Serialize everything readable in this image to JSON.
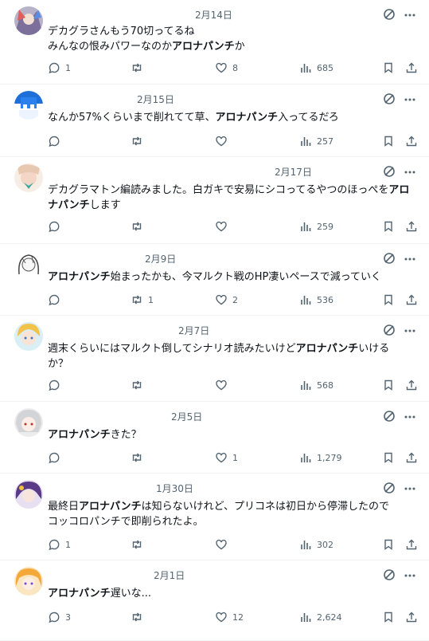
{
  "posts": [
    {
      "date": "2月14日",
      "segments": [
        {
          "t": "デカグラさんもう70切ってるね\nみんなの恨みパワーなのか"
        },
        {
          "t": "アロナパンチ",
          "b": true
        },
        {
          "t": "か"
        }
      ],
      "replies": "1",
      "retweets": "",
      "likes": "8",
      "views": "685"
    },
    {
      "date": "2月15日",
      "segments": [
        {
          "t": "なんか57%くらいまで削れてて草、"
        },
        {
          "t": "アロナパンチ",
          "b": true
        },
        {
          "t": "入ってるだろ"
        }
      ],
      "replies": "",
      "retweets": "",
      "likes": "",
      "views": "257"
    },
    {
      "date": "2月17日",
      "segments": [
        {
          "t": "デカグラマトン編読みました。白ガキで安易にシコってるやつのほっぺを"
        },
        {
          "t": "アロナパンチ",
          "b": true
        },
        {
          "t": "します"
        }
      ],
      "replies": "",
      "retweets": "",
      "likes": "",
      "views": "259"
    },
    {
      "date": "2月9日",
      "segments": [
        {
          "t": "アロナパンチ",
          "b": true
        },
        {
          "t": "始まったかも、今マルクト戦のHP凄いペースで減っていく"
        }
      ],
      "replies": "",
      "retweets": "1",
      "likes": "2",
      "views": "536"
    },
    {
      "date": "2月7日",
      "segments": [
        {
          "t": "週末くらいにはマルクト倒してシナリオ読みたいけど"
        },
        {
          "t": "アロナパンチ",
          "b": true
        },
        {
          "t": "いけるか？"
        }
      ],
      "replies": "",
      "retweets": "",
      "likes": "",
      "views": "568"
    },
    {
      "date": "2月5日",
      "segments": [
        {
          "t": "アロナパンチ",
          "b": true
        },
        {
          "t": "きた？"
        }
      ],
      "replies": "",
      "retweets": "",
      "likes": "1",
      "views": "1,279"
    },
    {
      "date": "1月30日",
      "segments": [
        {
          "t": "最終日"
        },
        {
          "t": "アロナパンチ",
          "b": true
        },
        {
          "t": "は知らないけれど、プリコネは初日から停滞したので\nコッコロパンチで即削られたよ。"
        }
      ],
      "replies": "1",
      "retweets": "",
      "likes": "",
      "views": "302"
    },
    {
      "date": "2月1日",
      "segments": [
        {
          "t": "アロナパンチ",
          "b": true
        },
        {
          "t": "遅いな..."
        }
      ],
      "replies": "3",
      "retweets": "",
      "likes": "12",
      "views": "2,624"
    }
  ],
  "icons": {
    "reply": "reply-icon",
    "retweet": "retweet-icon",
    "like": "heart-icon",
    "views": "views-icon",
    "bookmark": "bookmark-icon",
    "share": "share-icon",
    "grok": "grok-icon",
    "more": "more-icon"
  },
  "colors": {
    "text": "#0f1419",
    "muted": "#536471",
    "divider": "#eff3f4"
  }
}
